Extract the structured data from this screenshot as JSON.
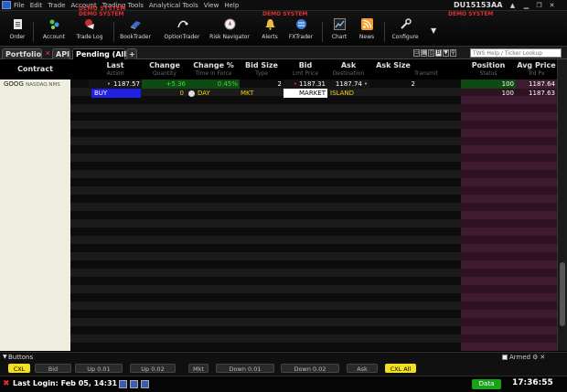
{
  "menu": {
    "items": [
      "File",
      "Edit",
      "Trade",
      "Account",
      "Trading Tools",
      "Analytical Tools",
      "View",
      "Help"
    ],
    "demo_label": "DEMO SYSTEM",
    "account_id": "DU15153",
    "font_size_label": "AA"
  },
  "toolbar": {
    "demo_banners": [
      "DEMO SYSTEM",
      "DEMO SYSTEM",
      "DEMO SYSTEM"
    ],
    "buttons": [
      {
        "label": "Order",
        "icon": "order-icon"
      },
      {
        "label": "Account",
        "icon": "account-icon"
      },
      {
        "label": "Trade Log",
        "icon": "trade-log-icon"
      },
      {
        "label": "BookTrader",
        "icon": "booktrader-icon"
      },
      {
        "label": "OptionTrader",
        "icon": "optiontrader-icon"
      },
      {
        "label": "Risk Navigator",
        "icon": "risk-navigator-icon"
      },
      {
        "label": "Alerts",
        "icon": "alerts-icon"
      },
      {
        "label": "FXTrader",
        "icon": "fxtrader-icon"
      },
      {
        "label": "Chart",
        "icon": "chart-icon"
      },
      {
        "label": "News",
        "icon": "news-icon"
      },
      {
        "label": "Configure",
        "icon": "configure-icon"
      }
    ]
  },
  "tabs": {
    "items": [
      {
        "label": "Portfolio",
        "active": false
      },
      {
        "label": "API",
        "active": false
      },
      {
        "label": "Pending (All)",
        "active": true
      }
    ],
    "add_label": "+",
    "search_placeholder": "TWS Help / Ticker Lookup"
  },
  "grid": {
    "columns": [
      {
        "label": "Contract",
        "sub": ""
      },
      {
        "label": "Last",
        "sub": "Action"
      },
      {
        "label": "Change",
        "sub": "Quantity"
      },
      {
        "label": "Change %",
        "sub": "Time in Force"
      },
      {
        "label": "Bid Size",
        "sub": "Type"
      },
      {
        "label": "Bid",
        "sub": "Lmt Price"
      },
      {
        "label": "Ask",
        "sub": "Destination"
      },
      {
        "label": "Ask Size",
        "sub": "Transmit"
      },
      {
        "label": "Position",
        "sub": "Status"
      },
      {
        "label": "Avg Price",
        "sub": "Trd Px"
      }
    ],
    "row_market": {
      "symbol": "GOOG",
      "exchange": "NASDAQ.NMS",
      "last": "1187.57",
      "change": "+5.36",
      "change_pct": "0.45%",
      "bid_size": "2",
      "bid": "1187.31",
      "ask": "1187.74",
      "ask_size": "2",
      "position": "100",
      "avg_price": "1187.64"
    },
    "row_order": {
      "action": "BUY",
      "quantity": "0",
      "tif": "DAY",
      "type": "MKT",
      "lmt_price": "MARKET",
      "destination": "ISLAND",
      "position": "100",
      "avg_price": "1187.63"
    }
  },
  "buttons_panel": {
    "title": "Buttons",
    "buttons": [
      "CXL",
      "Bid",
      "Up 0.01",
      "Up 0.02",
      "Mkt",
      "Down 0.01",
      "Down 0.02",
      "Ask",
      "CXL All"
    ],
    "armed_label": "Armed"
  },
  "status": {
    "last_login": "Last Login: Feb 05, 14:31",
    "data_label": "Data",
    "time": "17:36:55"
  },
  "colors": {
    "demo_red": "#e03030",
    "buy_blue": "#2020e0",
    "positive_green": "#3fd83f",
    "order_yellow": "#f0d000",
    "data_green": "#18a318"
  }
}
